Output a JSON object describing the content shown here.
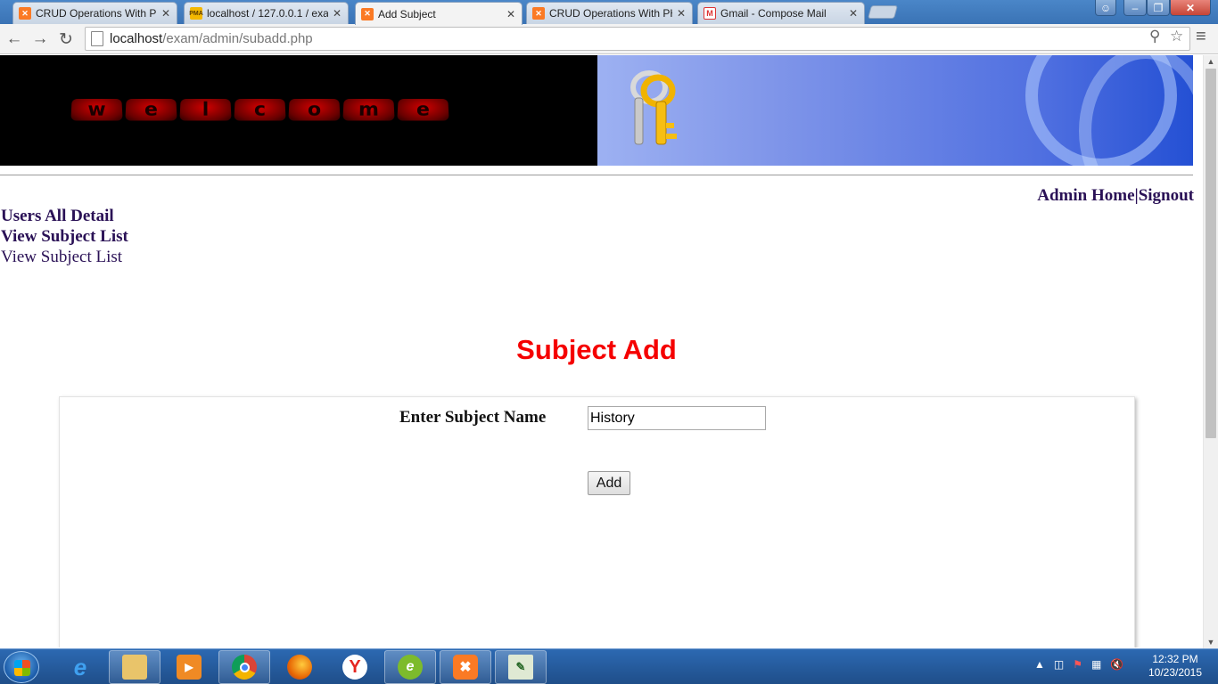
{
  "browser": {
    "tabs": [
      {
        "label": "CRUD Operations With PH",
        "icon": "xampp-icon",
        "active": false
      },
      {
        "label": "localhost / 127.0.0.1 / exa",
        "icon": "phpmyadmin-icon",
        "active": false
      },
      {
        "label": "Add Subject",
        "icon": "xampp-icon",
        "active": true
      },
      {
        "label": "CRUD Operations With PH",
        "icon": "xampp-icon",
        "active": false
      },
      {
        "label": "Gmail - Compose Mail",
        "icon": "gmail-icon",
        "active": false
      }
    ],
    "url_host": "localhost",
    "url_path": "/exam/admin/subadd.php"
  },
  "page": {
    "banner_text": [
      "w",
      "e",
      "l",
      "c",
      "o",
      "m",
      "e"
    ],
    "nav": {
      "admin_home": "Admin Home",
      "separator": "|",
      "signout": "Signout"
    },
    "sidebar": [
      {
        "label": "Users All Detail",
        "bold": true
      },
      {
        "label": "View Subject List",
        "bold": true
      },
      {
        "label": "View Subject List",
        "bold": false
      }
    ],
    "heading": "Subject Add",
    "form": {
      "label": "Enter Subject Name",
      "subject_value": "History",
      "submit_label": "Add"
    },
    "colors": {
      "heading": "#f50000",
      "link": "#2a1156"
    }
  },
  "taskbar": {
    "time": "12:32 PM",
    "date": "10/23/2015"
  }
}
